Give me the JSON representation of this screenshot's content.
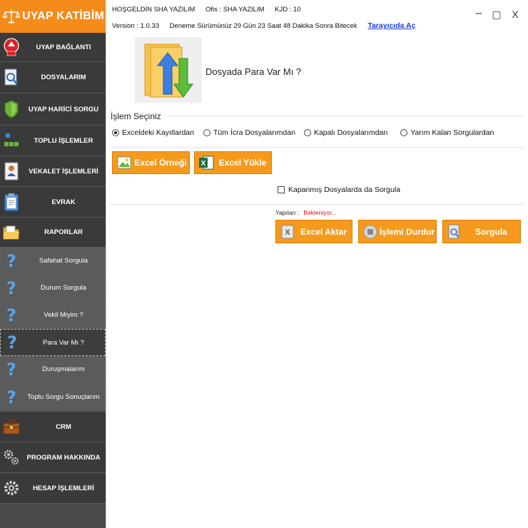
{
  "app": {
    "brand": "UYAP KATİBİM"
  },
  "info": {
    "welcome": "HOŞGELDİN SHA YAZILIM",
    "office": "Ofis : SHA YAZILIM",
    "kjd": "KJD : 10",
    "version": "Version : 1.0.33",
    "trial": "Deneme Sürümünüz 29 Gün 23 Saat 48 Dakika Sonra Bitecek",
    "browser_link": "Tarayıcıda Aç"
  },
  "window": {
    "minimize": "–",
    "maximize": "▢",
    "close": "X"
  },
  "sidebar": {
    "items": [
      {
        "label": "UYAP BAĞLANTI",
        "icon": "uyap-logo-icon"
      },
      {
        "label": "DOSYALARIM",
        "icon": "document-search-icon"
      },
      {
        "label": "UYAP HARİCİ SORGU",
        "icon": "shield-icon"
      },
      {
        "label": "TOPLU İŞLEMLER",
        "icon": "blocks-icon"
      },
      {
        "label": "VEKALET İŞLEMLERİ",
        "icon": "id-card-icon"
      },
      {
        "label": "EVRAK",
        "icon": "clipboard-icon"
      },
      {
        "label": "RAPORLAR",
        "icon": "folder-icon"
      },
      {
        "label": "Safahat Sorgula",
        "icon": "question-icon"
      },
      {
        "label": "Durum Sorgula",
        "icon": "question-icon"
      },
      {
        "label": "Vekil Miyim ?",
        "icon": "question-icon"
      },
      {
        "label": "Para Var Mı ?",
        "icon": "question-icon"
      },
      {
        "label": "Duruşmalarım",
        "icon": "question-icon"
      },
      {
        "label": "Toplu Sorgu Sonuçlarım",
        "icon": "question-icon"
      },
      {
        "label": "CRM",
        "icon": "briefcase-icon"
      },
      {
        "label": "PROGRAM HAKKINDA",
        "icon": "gears-icon"
      },
      {
        "label": "HESAP İŞLEMLERİ",
        "icon": "gear-icon"
      }
    ],
    "active": "Para Var Mı ?"
  },
  "main": {
    "title": "Dosyada Para Var Mı ?",
    "group_label": "İşlem Seçiniz",
    "radios": [
      {
        "label": "Exceldeki Kayıtlardan",
        "selected": true
      },
      {
        "label": "Tüm İcra Dosyalarımdan",
        "selected": false
      },
      {
        "label": "Kapalı Dosyalarımdan",
        "selected": false
      },
      {
        "label": "Yarım Kalan Sorgulardan",
        "selected": false
      }
    ],
    "excel_sample_button": "Excel Örneği",
    "excel_upload_button": "Excel Yükle",
    "closed_files_checkbox": {
      "label": "Kapanmış Dosyalarda da Sorgula",
      "checked": false
    },
    "status_label": "Yapılan :",
    "status_value": "Bekleniyor...",
    "export_button": "Excel Aktar",
    "stop_button": "İşlemi Durdur",
    "query_button": "Sorgula"
  },
  "colors": {
    "accent": "#f59a1c",
    "sidebar_dark": "#3a3a3a",
    "sidebar_light": "#5b5b5b",
    "link": "#1a3fd8",
    "status_red": "#d0161b"
  }
}
